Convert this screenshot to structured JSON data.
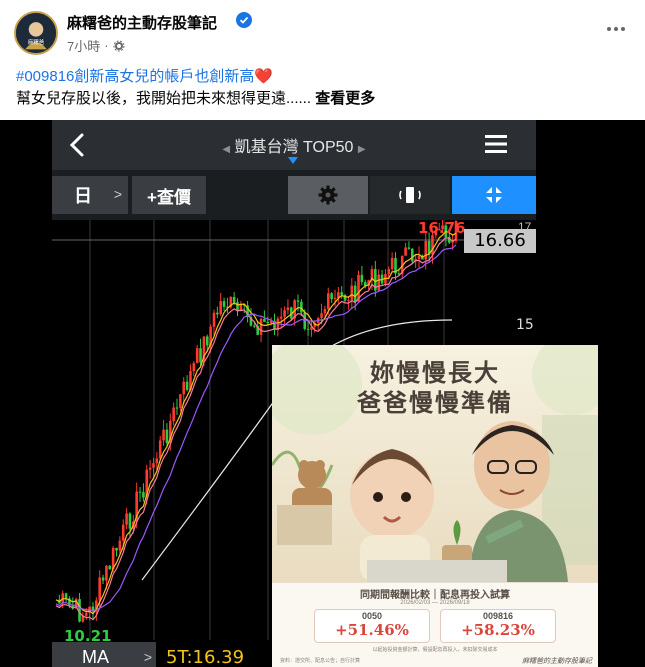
{
  "post": {
    "author": "麻糬爸的主動存股筆記",
    "time": "7小時",
    "separator": "·",
    "hashtag": "#009816創新高女兒的帳戶也創新高",
    "heart": "❤️",
    "body_text": "幫女兒存股以後，我開始把未來想得更遠......",
    "see_more": "查看更多"
  },
  "app": {
    "stock_name": "凱基台灣 TOP50",
    "day_label": "日",
    "query_label": "+查價",
    "ma_label": "MA",
    "ma5_text": "5T:16.39",
    "price_high": "16.76",
    "price_current": "16.66",
    "price_low": "10.21",
    "axis_17": "17",
    "axis_15": "15",
    "colors": {
      "up": "#ff3b30",
      "down": "#2ecc40",
      "accent": "#1e90ff",
      "ma5": "#f5c518"
    }
  },
  "poster": {
    "title_line1": "妳慢慢長大",
    "title_line2": "爸爸慢慢準備",
    "panel_title": "同期間報酬比較｜配息再投入試算",
    "date_range": "2026/02/03 — 2026/09/18",
    "fund_a_code": "0050",
    "fund_a_return": "+51.46%",
    "fund_b_code": "009816",
    "fund_b_return": "+58.23%",
    "note": "以起始投資金額計算，假設配息再投入，未扣除交易成本",
    "footer": "資料：證交所、配息公告；自行計算",
    "signature": "麻糬爸的主動存股筆記"
  },
  "icons": [
    "back-icon",
    "menu-icon",
    "gear-icon",
    "rotate-icon",
    "fullscreen-icon",
    "verified-icon",
    "globe-gear-icon",
    "more-icon"
  ]
}
